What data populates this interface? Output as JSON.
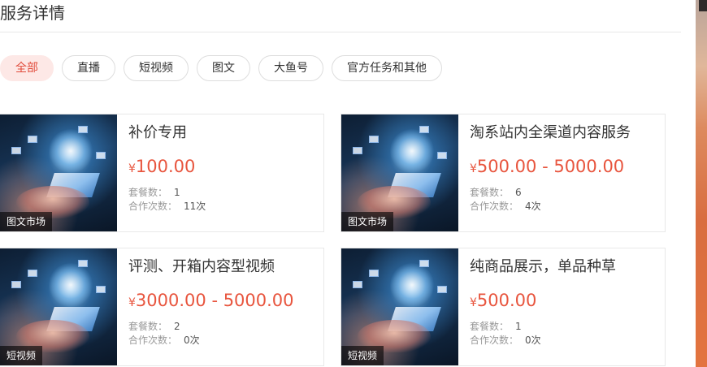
{
  "page": {
    "title": "服务详情"
  },
  "filters": [
    {
      "label": "全部",
      "active": true
    },
    {
      "label": "直播",
      "active": false
    },
    {
      "label": "短视频",
      "active": false
    },
    {
      "label": "图文",
      "active": false
    },
    {
      "label": "大鱼号",
      "active": false
    },
    {
      "label": "官方任务和其他",
      "active": false
    }
  ],
  "meta_labels": {
    "packages": "套餐数：",
    "orders": "合作次数："
  },
  "currency": "¥",
  "cards": [
    {
      "badge": "图文市场",
      "title": "补价专用",
      "price": "100.00",
      "packages": "1",
      "orders": "11次"
    },
    {
      "badge": "图文市场",
      "title": "淘系站内全渠道内容服务",
      "price": "500.00 - 5000.00",
      "packages": "6",
      "orders": "4次"
    },
    {
      "badge": "短视频",
      "title": "评测、开箱内容型视频",
      "price": "3000.00 - 5000.00",
      "packages": "2",
      "orders": "0次"
    },
    {
      "badge": "短视频",
      "title": "纯商品展示，单品种草",
      "price": "500.00",
      "packages": "1",
      "orders": "0次"
    }
  ],
  "colors": {
    "accent": "#e8553e",
    "chip_active_bg": "#fde8e6",
    "chip_active_text": "#e14b3b"
  }
}
